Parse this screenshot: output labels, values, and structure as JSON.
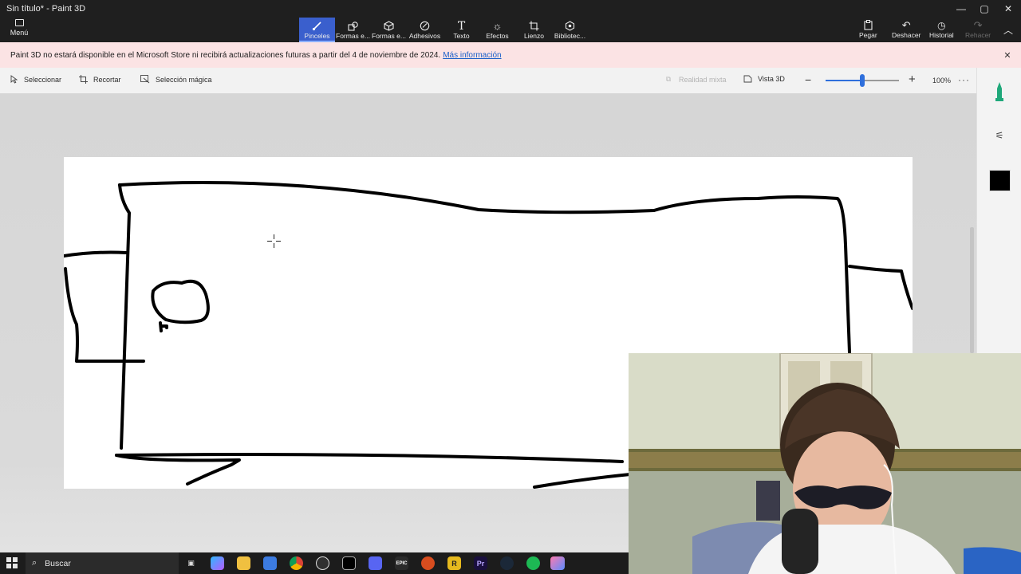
{
  "window": {
    "title": "Sin título* - Paint 3D",
    "controls": {
      "minimize": "—",
      "maximize": "▢",
      "close": "✕"
    }
  },
  "ribbon": {
    "menu_label": "Menú",
    "tools": [
      {
        "label": "Pinceles",
        "icon": "brush-icon",
        "active": true
      },
      {
        "label": "Formas e...",
        "icon": "shapes-2d-icon",
        "active": false
      },
      {
        "label": "Formas e...",
        "icon": "shapes-3d-icon",
        "active": false
      },
      {
        "label": "Adhesivos",
        "icon": "stickers-icon",
        "active": false
      },
      {
        "label": "Texto",
        "icon": "text-icon",
        "active": false
      },
      {
        "label": "Efectos",
        "icon": "effects-icon",
        "active": false
      },
      {
        "label": "Lienzo",
        "icon": "canvas-icon",
        "active": false
      },
      {
        "label": "Bibliotec...",
        "icon": "library-icon",
        "active": false
      }
    ],
    "paste_label": "Pegar",
    "undo_label": "Deshacer",
    "history_label": "Historial",
    "redo_label": "Rehacer"
  },
  "banner": {
    "message": "Paint 3D no estará disponible en el Microsoft Store ni recibirá actualizaciones futuras a partir del 4 de noviembre de 2024.",
    "link": "Más información"
  },
  "toolbar": {
    "select_label": "Seleccionar",
    "crop_label": "Recortar",
    "magic_select_label": "Selección mágica",
    "mixed_reality_label": "Realidad mixta",
    "view3d_label": "Vista 3D",
    "zoom_value": "100%",
    "zoom_fraction": 0.5
  },
  "side_panel": {
    "active_color": "#000000"
  },
  "taskbar": {
    "search_placeholder": "Buscar",
    "apps": [
      "task-view",
      "copilot",
      "file-explorer",
      "store",
      "chrome",
      "obs",
      "capcut",
      "discord",
      "epic-games",
      "rockstar",
      "r-app",
      "premiere-pro",
      "steam",
      "spotify",
      "paint-3d"
    ]
  },
  "colors": {
    "accent": "#3a5fcd",
    "banner_bg": "#fbe3e4",
    "link": "#1a5fc9"
  }
}
